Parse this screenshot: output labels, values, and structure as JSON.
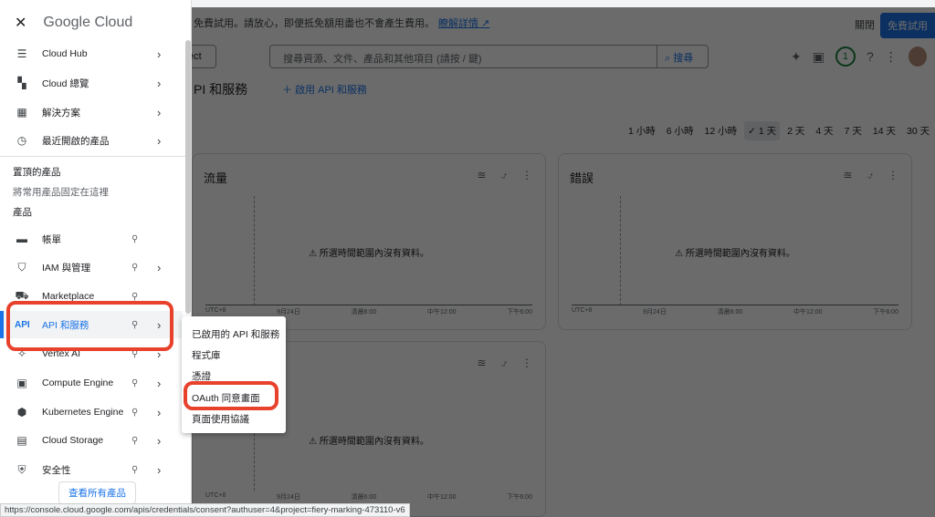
{
  "banner": {
    "text": "免費試用。請放心，即便抵免額用盡也不會產生費用。",
    "link": "瞭解詳情 ↗",
    "close": "關閉",
    "trial": "免費試用"
  },
  "toolbar": {
    "project": "ect",
    "search_placeholder": "搜尋資源、文件、產品和其他項目 (請按 / 鍵)",
    "search_button": "搜尋",
    "notifications": "1"
  },
  "page": {
    "title": "PI 和服務",
    "enable": "啟用 API 和服務"
  },
  "time_ranges": [
    "1 小時",
    "6 小時",
    "12 小時",
    "✓ 1 天",
    "2 天",
    "4 天",
    "7 天",
    "14 天",
    "30 天"
  ],
  "cards": [
    {
      "title": "流量",
      "empty": "所選時間範圍內沒有資料。",
      "ticks": [
        "UTC+8",
        "9月24日",
        "清晨6:00",
        "中午12:00",
        "下午6:00"
      ]
    },
    {
      "title": "錯誤",
      "empty": "所選時間範圍內沒有資料。",
      "ticks": [
        "UTC+8",
        "9月24日",
        "清晨6:00",
        "中午12:00",
        "下午6:00"
      ]
    },
    {
      "title": "",
      "empty": "所選時間範圍內沒有資料。",
      "ticks": [
        "UTC+8",
        "9月24日",
        "清晨6:00",
        "中午12:00",
        "下午6:00"
      ]
    }
  ],
  "sidebar": {
    "logo": "Google Cloud",
    "top_items": [
      {
        "label": "Cloud Hub",
        "icon": "tune"
      },
      {
        "label": "Cloud 總覽",
        "icon": "dashboard"
      },
      {
        "label": "解決方案",
        "icon": "grid"
      },
      {
        "label": "最近開啟的產品",
        "icon": "clock"
      }
    ],
    "pinned_title": "置頂的產品",
    "pinned_hint": "將常用產品固定在這裡",
    "products_title": "產品",
    "products": [
      {
        "label": "帳單",
        "icon": "▬"
      },
      {
        "label": "IAM 與管理",
        "icon": "⛉"
      },
      {
        "label": "Marketplace",
        "icon": "⛟"
      },
      {
        "label": "API 和服務",
        "icon": "API"
      },
      {
        "label": "Vertex AI",
        "icon": "✧"
      },
      {
        "label": "Compute Engine",
        "icon": "▣"
      },
      {
        "label": "Kubernetes Engine",
        "icon": "⬢"
      },
      {
        "label": "Cloud Storage",
        "icon": "▤"
      },
      {
        "label": "安全性",
        "icon": "⛨"
      }
    ],
    "view_all": "查看所有產品"
  },
  "submenu": [
    "已啟用的 API 和服務",
    "程式庫",
    "憑證",
    "OAuth 同意畫面",
    "頁面使用協議"
  ],
  "status_url": "https://console.cloud.google.com/apis/credentials/consent?authuser=4&project=fiery-marking-473110-v6"
}
